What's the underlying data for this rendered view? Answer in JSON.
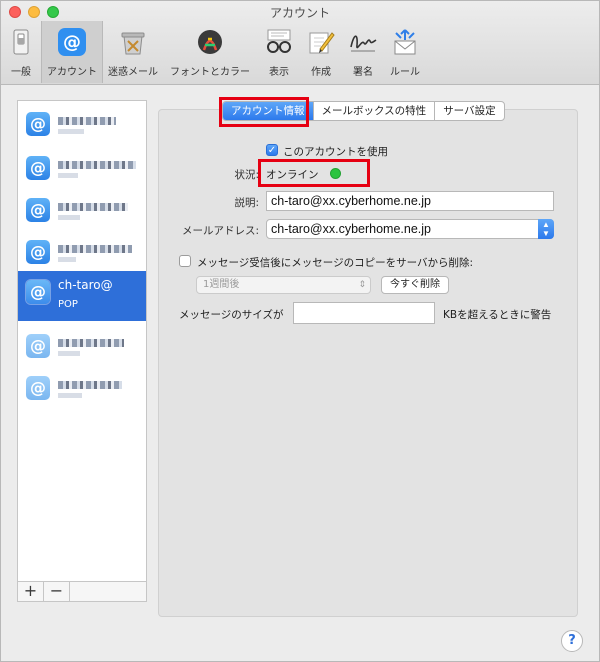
{
  "window": {
    "title": "アカウント"
  },
  "toolbar": {
    "items": [
      {
        "label": "一般",
        "icon": "general-switch-icon"
      },
      {
        "label": "アカウント",
        "icon": "at-sign-icon",
        "active": true
      },
      {
        "label": "迷惑メール",
        "icon": "junk-mail-icon"
      },
      {
        "label": "フォントとカラー",
        "icon": "font-color-icon"
      },
      {
        "label": "表示",
        "icon": "viewing-glasses-icon"
      },
      {
        "label": "作成",
        "icon": "compose-pencil-icon"
      },
      {
        "label": "署名",
        "icon": "signature-icon"
      },
      {
        "label": "ルール",
        "icon": "rules-envelope-icon"
      }
    ]
  },
  "accounts": {
    "selected": {
      "line1": "ch-taro@",
      "line2": "POP"
    },
    "add_label": "+",
    "remove_label": "−"
  },
  "tabs": [
    {
      "label": "アカウント情報",
      "active": true
    },
    {
      "label": "メールボックスの特性"
    },
    {
      "label": "サーバ設定"
    }
  ],
  "form": {
    "enable_label": "このアカウントを使用",
    "enable_checked": true,
    "status_label": "状況:",
    "status_value": "オンライン",
    "status_color": "#2ac43e",
    "description_label": "説明:",
    "description_value": "ch-taro@xx.cyberhome.ne.jp",
    "email_label": "メールアドレス:",
    "email_value": "ch-taro@xx.cyberhome.ne.jp",
    "remove_copy_label": "メッセージ受信後にメッセージのコピーをサーバから削除:",
    "remove_copy_checked": false,
    "remove_after_value": "1週間後",
    "remove_now_button": "今すぐ削除",
    "size_label": "メッセージのサイズが",
    "size_value": "",
    "size_suffix": "KBを超えるときに警告"
  },
  "help": {
    "label": "?"
  },
  "colors": {
    "accent": "#2e6fd9",
    "highlight": "#e60012"
  }
}
